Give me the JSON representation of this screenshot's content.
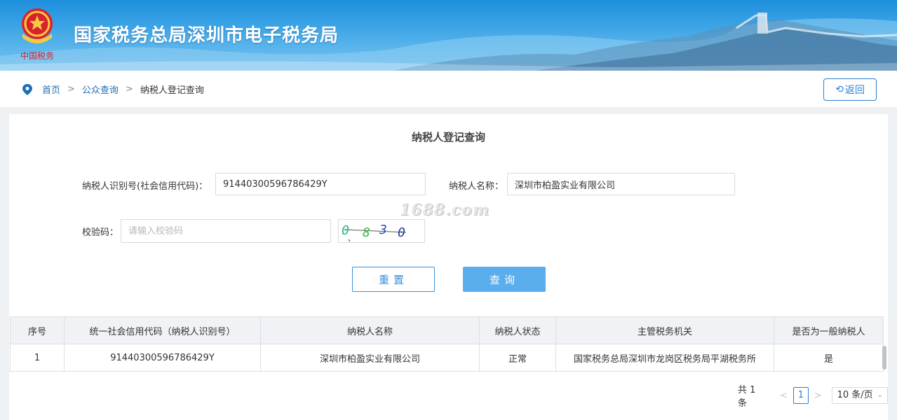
{
  "header": {
    "site_title": "国家税务总局深圳市电子税务局",
    "emblem_caption": "中国税务"
  },
  "breadcrumb": {
    "home": "首页",
    "public_query": "公众查询",
    "current": "纳税人登记查询",
    "separator": ">"
  },
  "back_button": {
    "icon": "undo-icon",
    "label": "返回"
  },
  "form": {
    "title": "纳税人登记查询",
    "taxpayer_id_label": "纳税人识别号(社会信用代码)：",
    "taxpayer_id_value": "91440300596786429Y",
    "taxpayer_name_label": "纳税人名称：",
    "taxpayer_name_value": "深圳市柏盈实业有限公司",
    "captcha_label": "校验码：",
    "captcha_placeholder": "请输入校验码",
    "captcha_text": "0830",
    "watermark": "1688.com",
    "reset_label": "重置",
    "query_label": "查询"
  },
  "table": {
    "headers": [
      "序号",
      "统一社会信用代码（纳税人识别号）",
      "纳税人名称",
      "纳税人状态",
      "主管税务机关",
      "是否为一般纳税人"
    ],
    "rows": [
      [
        "1",
        "91440300596786429Y",
        "深圳市柏盈实业有限公司",
        "正常",
        "国家税务总局深圳市龙岗区税务局平湖税务所",
        "是"
      ]
    ]
  },
  "pagination": {
    "total": "共 1 条",
    "prev": "<",
    "page": "1",
    "next": ">",
    "page_size": "10 条/页"
  },
  "colors": {
    "accent": "#2b7fd0",
    "query_button": "#5aaeee",
    "banner": "#3aa3e6"
  }
}
